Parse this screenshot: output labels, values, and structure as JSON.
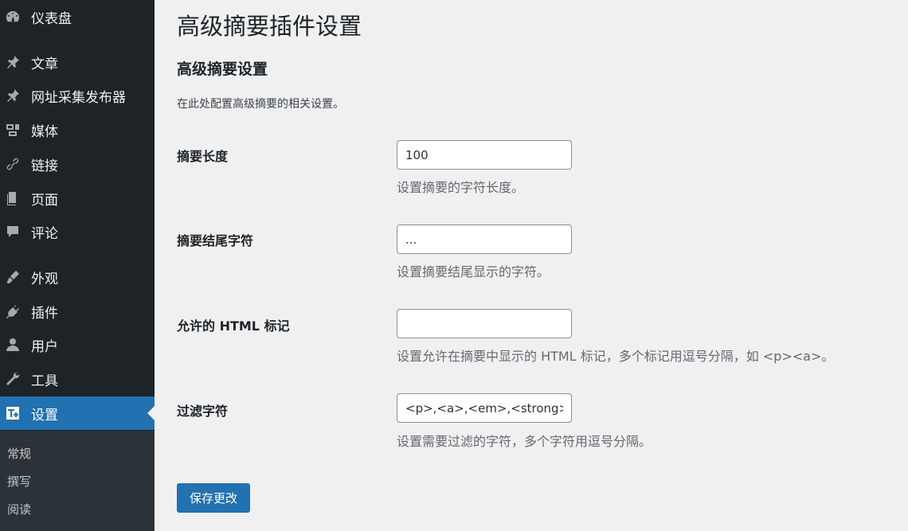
{
  "sidebar": {
    "items": [
      {
        "label": "仪表盘",
        "icon": "dashboard-icon"
      },
      {
        "label": "文章",
        "icon": "pin-icon"
      },
      {
        "label": "网址采集发布器",
        "icon": "pin-icon"
      },
      {
        "label": "媒体",
        "icon": "media-icon"
      },
      {
        "label": "链接",
        "icon": "link-icon"
      },
      {
        "label": "页面",
        "icon": "page-icon"
      },
      {
        "label": "评论",
        "icon": "comment-icon"
      },
      {
        "label": "外观",
        "icon": "appearance-icon"
      },
      {
        "label": "插件",
        "icon": "plugin-icon"
      },
      {
        "label": "用户",
        "icon": "user-icon"
      },
      {
        "label": "工具",
        "icon": "tools-icon"
      },
      {
        "label": "设置",
        "icon": "settings-icon",
        "active": true
      }
    ],
    "submenu": [
      "常规",
      "撰写",
      "阅读"
    ]
  },
  "main": {
    "page_title": "高级摘要插件设置",
    "section_title": "高级摘要设置",
    "section_desc": "在此处配置高级摘要的相关设置。",
    "fields": [
      {
        "label": "摘要长度",
        "value": "100",
        "desc": "设置摘要的字符长度。"
      },
      {
        "label": "摘要结尾字符",
        "value": "...",
        "desc": "设置摘要结尾显示的字符。"
      },
      {
        "label": "允许的 HTML 标记",
        "value": "",
        "desc": "设置允许在摘要中显示的 HTML 标记，多个标记用逗号分隔，如 <p><a>。"
      },
      {
        "label": "过滤字符",
        "value": "<p>,<a>,<em>,<strong>",
        "desc": "设置需要过滤的字符，多个字符用逗号分隔。"
      }
    ],
    "save_label": "保存更改"
  },
  "colors": {
    "sidebar_bg": "#1d2327",
    "accent": "#2271b1",
    "page_bg": "#f0f0f1"
  }
}
